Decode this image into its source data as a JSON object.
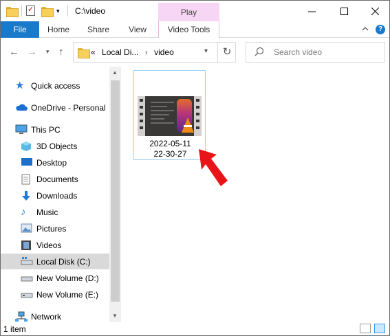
{
  "window": {
    "title": "C:\\video",
    "contextual_tab": "Play",
    "minimize_icon": "minimize-icon",
    "maximize_icon": "maximize-icon",
    "close_icon": "close-icon"
  },
  "ribbon": {
    "tabs": [
      "File",
      "Home",
      "Share",
      "View",
      "Video Tools"
    ]
  },
  "address": {
    "overflow": "«",
    "crumbs": [
      "Local Di...",
      "video"
    ],
    "separator": "›"
  },
  "search": {
    "placeholder": "Search video"
  },
  "nav": {
    "quick_access": "Quick access",
    "onedrive": "OneDrive - Personal",
    "this_pc": "This PC",
    "items": [
      "3D Objects",
      "Desktop",
      "Documents",
      "Downloads",
      "Music",
      "Pictures",
      "Videos",
      "Local Disk (C:)",
      "New Volume (D:)",
      "New Volume (E:)"
    ],
    "network": "Network"
  },
  "content": {
    "file": {
      "line1": "2022-05-11",
      "line2": "22-30-27"
    }
  },
  "status": {
    "count": "1 item"
  },
  "colors": {
    "accent": "#1979ca",
    "play_tab": "#f7d6f5",
    "selection": "#cce8ff",
    "pointer_arrow": "#e8141a"
  }
}
